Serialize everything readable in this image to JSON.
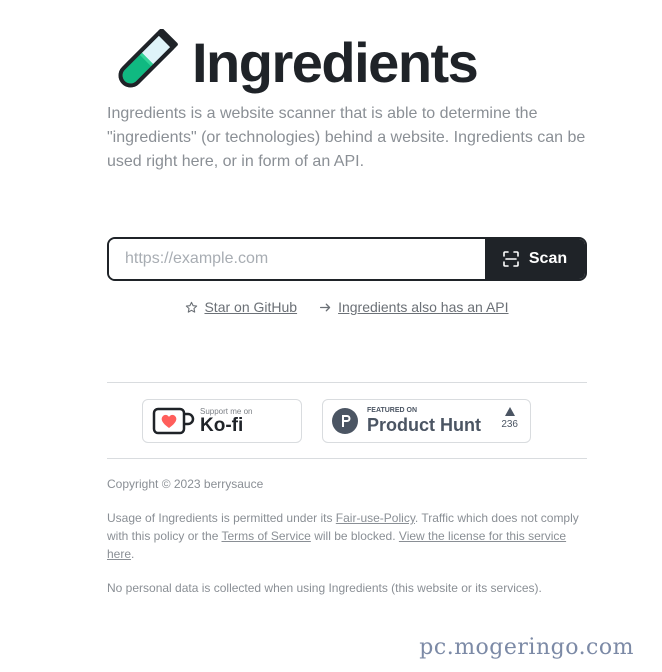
{
  "header": {
    "title": "Ingredients",
    "description": "Ingredients is a website scanner that is able to determine the \"ingredients\" (or technologies) behind a website. Ingredients can be used right here, or in form of an API."
  },
  "search": {
    "placeholder": "https://example.com",
    "value": "",
    "scan_label": "Scan"
  },
  "links": {
    "github_label": "Star on GitHub",
    "api_label": "Ingredients also has an API"
  },
  "badges": {
    "kofi_small": "Support me on",
    "kofi_big": "Ko-fi",
    "ph_small": "FEATURED ON",
    "ph_big": "Product Hunt",
    "ph_votes": "236"
  },
  "footer": {
    "copyright": "Copyright © 2023 berrysauce",
    "usage_1": "Usage of Ingredients is permitted under its ",
    "fair_use_link": "Fair-use-Policy",
    "usage_2": ". Traffic which does not comply with this policy or the ",
    "tos_link": "Terms of Service",
    "usage_3": " will be blocked. ",
    "license_link": "View the license for this service here",
    "usage_4": ".",
    "privacy": "No personal data is collected when using Ingredients (this website or its services)."
  },
  "watermark": "pc.mogeringo.com",
  "colors": {
    "dark": "#1f2328",
    "muted": "#8a8f95",
    "tube_liquid": "#10b981",
    "kofi_heart": "#ff5e5b",
    "ph_badge": "#4b5563"
  }
}
